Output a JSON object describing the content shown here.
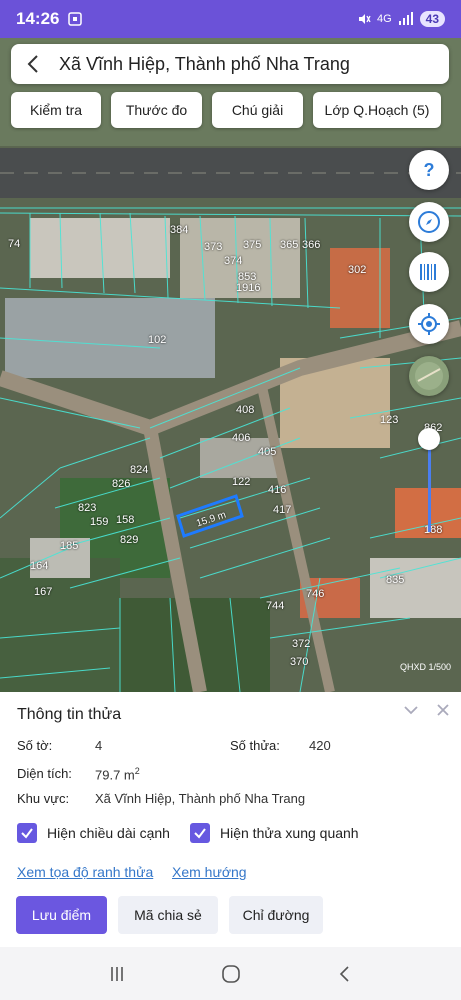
{
  "status": {
    "time": "14:26",
    "battery": "43",
    "signal_label": "4G"
  },
  "search": {
    "title": "Xã Vĩnh Hiệp, Thành phố Nha Trang"
  },
  "chips": [
    "Kiểm tra",
    "Thước đo",
    "Chú giải",
    "Lớp Q.Hoạch (5)"
  ],
  "map": {
    "parcel_numbers": [
      "74",
      "384",
      "373",
      "375",
      "365",
      "366",
      "374",
      "853",
      "302",
      "102",
      "408",
      "406",
      "405",
      "122",
      "416",
      "417",
      "824",
      "826",
      "823",
      "158",
      "829",
      "185",
      "164",
      "167",
      "159",
      "746",
      "744",
      "372",
      "370",
      "835",
      "123",
      "188",
      "862",
      "1916"
    ],
    "measure_label": "15.9 m",
    "scale": "QHXD 1/500"
  },
  "panel": {
    "title": "Thông tin thửa",
    "so_to_label": "Số tờ:",
    "so_to_value": "4",
    "so_thua_label": "Số thửa:",
    "so_thua_value": "420",
    "dien_tich_label": "Diện tích:",
    "dien_tich_value": "79.7 m",
    "dien_tich_sup": "2",
    "khu_vuc_label": "Khu vực:",
    "khu_vuc_value": "Xã Vĩnh Hiệp, Thành phố Nha Trang",
    "check_1": "Hiện chiều dài cạnh",
    "check_2": "Hiện thửa xung quanh",
    "link_1": "Xem tọa độ ranh thửa",
    "link_2": "Xem hướng",
    "btn_save": "Lưu điểm",
    "btn_share": "Mã chia sẻ",
    "btn_directions": "Chỉ đường"
  },
  "colors": {
    "accent": "#6b57e0",
    "link": "#3577c9",
    "status_bar": "#6b52d8"
  }
}
